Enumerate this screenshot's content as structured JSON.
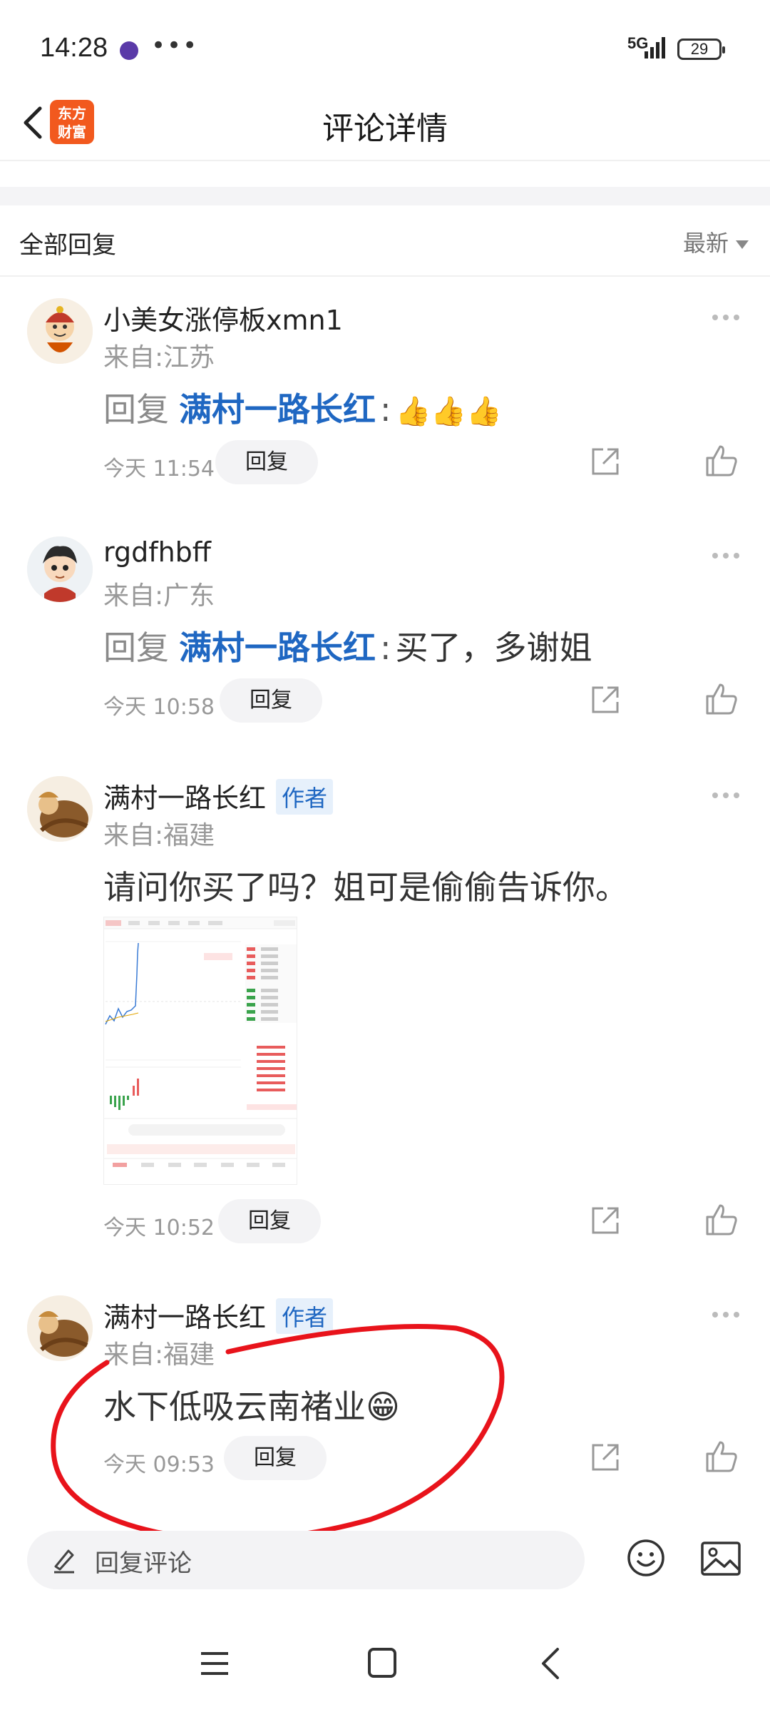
{
  "status_bar": {
    "time": "14:28",
    "dots": "•••",
    "network": "5G",
    "battery": "29"
  },
  "header": {
    "title": "评论详情",
    "logo_line1": "东方",
    "logo_line2": "财富"
  },
  "section": {
    "title": "全部回复",
    "sort": "最新"
  },
  "comments": [
    {
      "username": "小美女涨停板xmn1",
      "location": "来自:江苏",
      "reply_keyword": "回复",
      "mention": "满村一路长红",
      "colon": ":",
      "text": "👍👍👍",
      "time": "今天 11:54",
      "reply_label": "回复"
    },
    {
      "username": "rgdfhbff",
      "location": "来自:广东",
      "reply_keyword": "回复",
      "mention": "满村一路长红",
      "colon": ":",
      "text": "买了，多谢姐",
      "time": "今天 10:58",
      "reply_label": "回复"
    },
    {
      "username": "满村一路长红",
      "badge": "作者",
      "location": "来自:福建",
      "text": "请问你买了吗？姐可是偷偷告诉你。",
      "time": "今天 10:52",
      "reply_label": "回复"
    },
    {
      "username": "满村一路长红",
      "badge": "作者",
      "location": "来自:福建",
      "text": "水下低吸云南褚业😁",
      "time": "今天 09:53",
      "reply_label": "回复"
    }
  ],
  "bottom_bar": {
    "input_placeholder": "回复评论"
  },
  "icons": [
    "back-icon",
    "more-icon",
    "share-icon",
    "like-icon",
    "pen-icon",
    "emoji-icon",
    "image-icon"
  ],
  "colors": {
    "accent_blue": "#1f67c2",
    "logo_orange": "#f2591e",
    "annotation_red": "#e8131b"
  }
}
